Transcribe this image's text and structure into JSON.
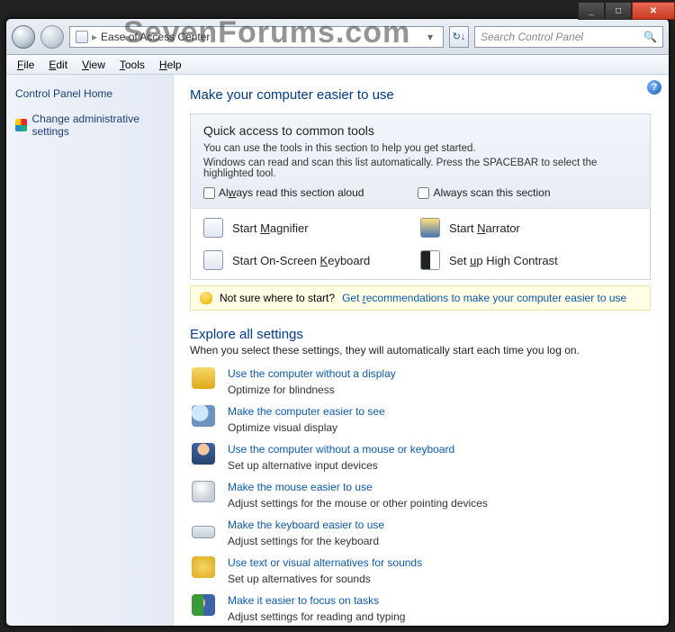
{
  "watermark": "SevenForums.com",
  "titlebar": {
    "min": "_",
    "max": "□",
    "close": "✕"
  },
  "address": {
    "icon": "control-panel-icon",
    "sep": "▸",
    "location": "Ease of Access Center",
    "refresh": "↻↓"
  },
  "search": {
    "placeholder": "Search Control Panel"
  },
  "menu": {
    "file": "File",
    "edit": "Edit",
    "view": "View",
    "tools": "Tools",
    "help": "Help"
  },
  "sidebar": {
    "home": "Control Panel Home",
    "admin": "Change administrative settings"
  },
  "page": {
    "title": "Make your computer easier to use",
    "qa_title": "Quick access to common tools",
    "qa_sub1": "You can use the tools in this section to help you get started.",
    "qa_sub2": "Windows can read and scan this list automatically.  Press the SPACEBAR to select the highlighted tool.",
    "chk_aloud": "Always read this section aloud",
    "chk_scan": "Always scan this section",
    "tools": {
      "magnifier": "Start Magnifier",
      "narrator": "Start Narrator",
      "osk": "Start On-Screen Keyboard",
      "contrast": "Set up High Contrast"
    },
    "tip_q": "Not sure where to start?",
    "tip_link": "Get recommendations to make your computer easier to use",
    "explore_title": "Explore all settings",
    "explore_sub": "When you select these settings, they will automatically start each time you log on.",
    "settings": [
      {
        "link": "Use the computer without a display",
        "desc": "Optimize for blindness"
      },
      {
        "link": "Make the computer easier to see",
        "desc": "Optimize visual display"
      },
      {
        "link": "Use the computer without a mouse or keyboard",
        "desc": "Set up alternative input devices"
      },
      {
        "link": "Make the mouse easier to use",
        "desc": "Adjust settings for the mouse or other pointing devices"
      },
      {
        "link": "Make the keyboard easier to use",
        "desc": "Adjust settings for the keyboard"
      },
      {
        "link": "Use text or visual alternatives for sounds",
        "desc": "Set up alternatives for sounds"
      },
      {
        "link": "Make it easier to focus on tasks",
        "desc": "Adjust settings for reading and typing"
      }
    ]
  }
}
